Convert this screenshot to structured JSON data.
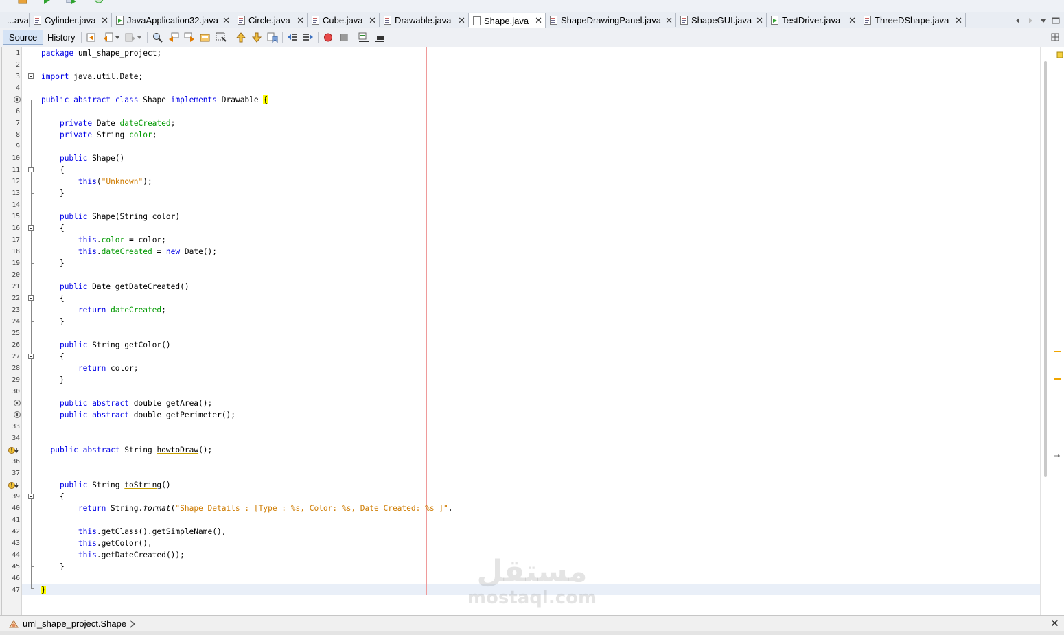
{
  "tabs": [
    {
      "label": "...ava",
      "active": false,
      "closable": false
    },
    {
      "label": "Cylinder.java",
      "active": false,
      "closable": true
    },
    {
      "label": "JavaApplication32.java",
      "active": false,
      "closable": true
    },
    {
      "label": "Circle.java",
      "active": false,
      "closable": true
    },
    {
      "label": "Cube.java",
      "active": false,
      "closable": true
    },
    {
      "label": "Drawable.java",
      "active": false,
      "closable": true
    },
    {
      "label": "Shape.java",
      "active": true,
      "closable": true
    },
    {
      "label": "ShapeDrawingPanel.java",
      "active": false,
      "closable": true
    },
    {
      "label": "ShapeGUI.java",
      "active": false,
      "closable": true
    },
    {
      "label": "TestDriver.java",
      "active": false,
      "closable": true
    },
    {
      "label": "ThreeDShape.java",
      "active": false,
      "closable": true
    }
  ],
  "tab_close_glyph": "✕",
  "editor_toolbar": {
    "source_label": "Source",
    "history_label": "History",
    "icons": [
      "last-edit-icon",
      "back-icon",
      "forward-icon",
      "find-icon",
      "find-previous-icon",
      "find-next-icon",
      "find-selection-icon",
      "toggle-highlight-icon",
      "previous-bookmark-icon",
      "next-bookmark-icon",
      "toggle-bookmark-icon",
      "shift-left-icon",
      "shift-right-icon",
      "start-macro-icon",
      "stop-macro-icon",
      "comment-icon",
      "uncomment-icon"
    ]
  },
  "code": {
    "line_numbers": [
      "1",
      "2",
      "3",
      "4",
      "",
      "6",
      "7",
      "8",
      "9",
      "10",
      "11",
      "12",
      "13",
      "14",
      "15",
      "16",
      "17",
      "18",
      "19",
      "20",
      "21",
      "22",
      "23",
      "24",
      "25",
      "26",
      "27",
      "28",
      "29",
      "30",
      "",
      "",
      "33",
      "34",
      "",
      "36",
      "37",
      "",
      "39",
      "40",
      "41",
      "42",
      "43",
      "44",
      "45",
      "46",
      "47"
    ],
    "lines": [
      "package uml_shape_project;",
      "",
      "import java.util.Date;",
      "",
      "public abstract class Shape implements Drawable {",
      "",
      "    private Date dateCreated;",
      "    private String color;",
      "",
      "    public Shape()",
      "    {",
      "        this(\"Unknown\");",
      "    }",
      "",
      "    public Shape(String color)",
      "    {",
      "        this.color = color;",
      "        this.dateCreated = new Date();",
      "    }",
      "",
      "    public Date getDateCreated()",
      "    {",
      "        return dateCreated;",
      "    }",
      "",
      "    public String getColor()",
      "    {",
      "        return color;",
      "    }",
      "",
      "    public abstract double getArea();",
      "    public abstract double getPerimeter();",
      "",
      "",
      "  public abstract String howtoDraw();",
      "",
      "",
      "    public String toString()",
      "    {",
      "        return String.format(\"Shape Details : [Type : %s, Color: %s, Date Created: %s ]\",",
      "",
      "        this.getClass().getSimpleName(),",
      "        this.getColor(),",
      "        this.getDateCreated());",
      "    }",
      "",
      "}"
    ]
  },
  "status": {
    "navigator_path": "uml_shape_project.Shape"
  },
  "watermark": {
    "arabic": "مستقل",
    "latin": "mostaql.com"
  },
  "colors": {
    "keyword": "#0000e6",
    "field": "#009900",
    "string": "#ce7b00",
    "brace_highlight": "#ffff00",
    "margin_line": "#ef9a9a",
    "scroll_marker": "#f0a500"
  }
}
